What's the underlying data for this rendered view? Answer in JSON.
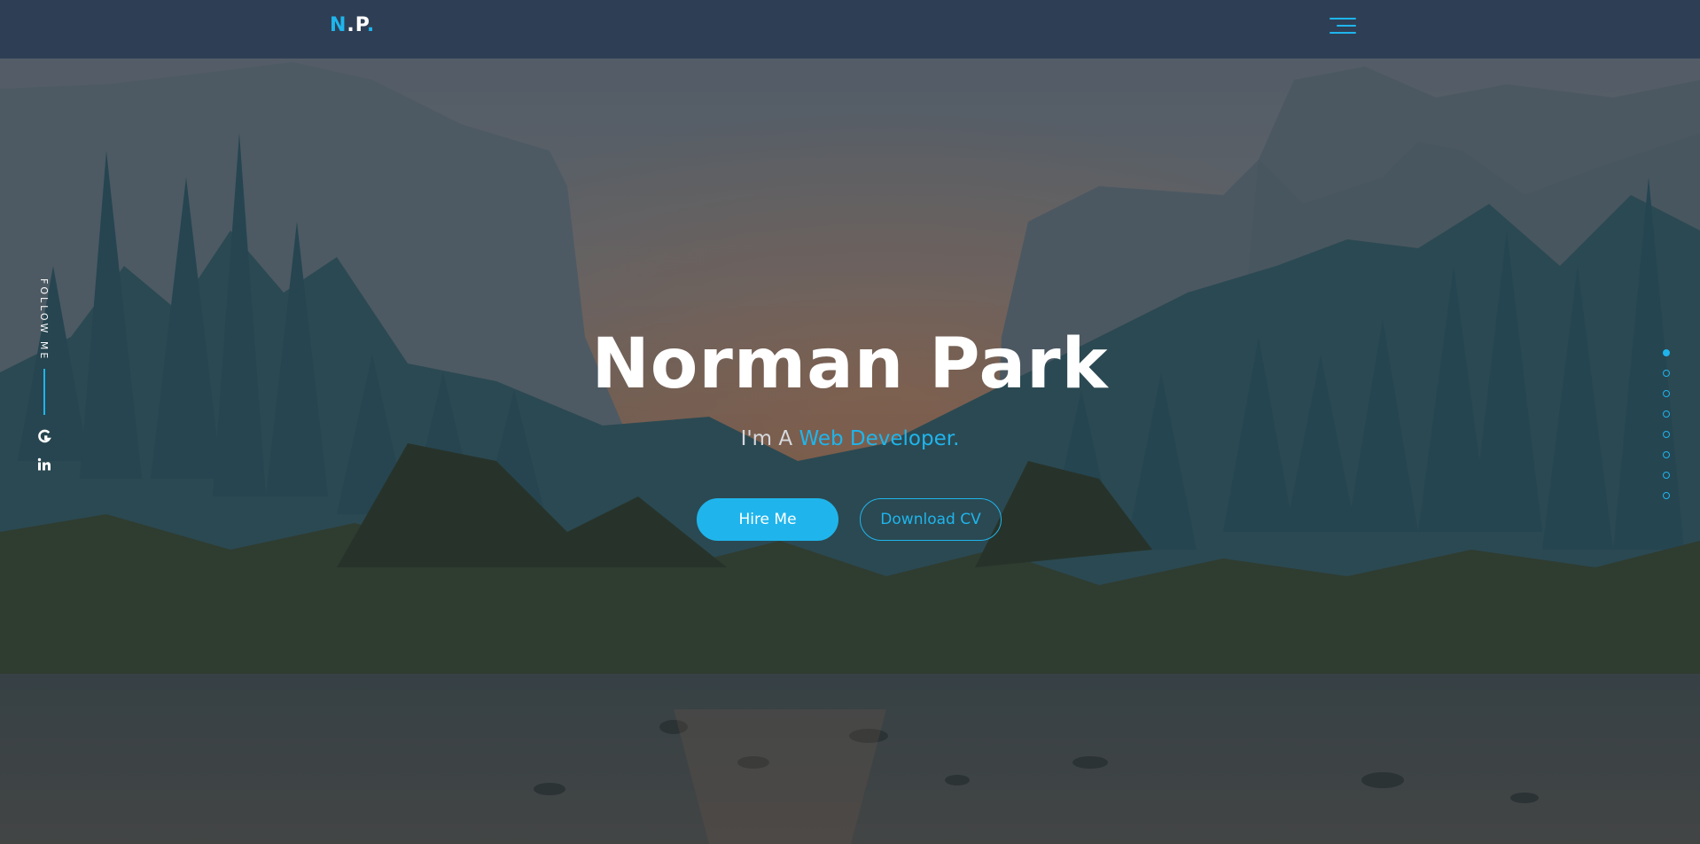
{
  "brand": {
    "logo_letter1": "N",
    "logo_dot1": ".",
    "logo_letter2": "P",
    "logo_dot2": "."
  },
  "navbar": {
    "menu_icon": "hamburger-menu-icon"
  },
  "follow": {
    "label": "FOLLOW ME",
    "links": [
      {
        "icon": "github-icon"
      },
      {
        "icon": "linkedin-icon"
      }
    ]
  },
  "hero": {
    "name": "Norman Park",
    "intro": "I'm A",
    "role": "Web Developer.",
    "hire_label": "Hire Me",
    "cv_label": "Download CV"
  },
  "section_dots": {
    "count": 8,
    "active_index": 0
  },
  "colors": {
    "accent": "#1fb5ec",
    "navbar": "#2e3f55",
    "text": "#ffffff"
  }
}
